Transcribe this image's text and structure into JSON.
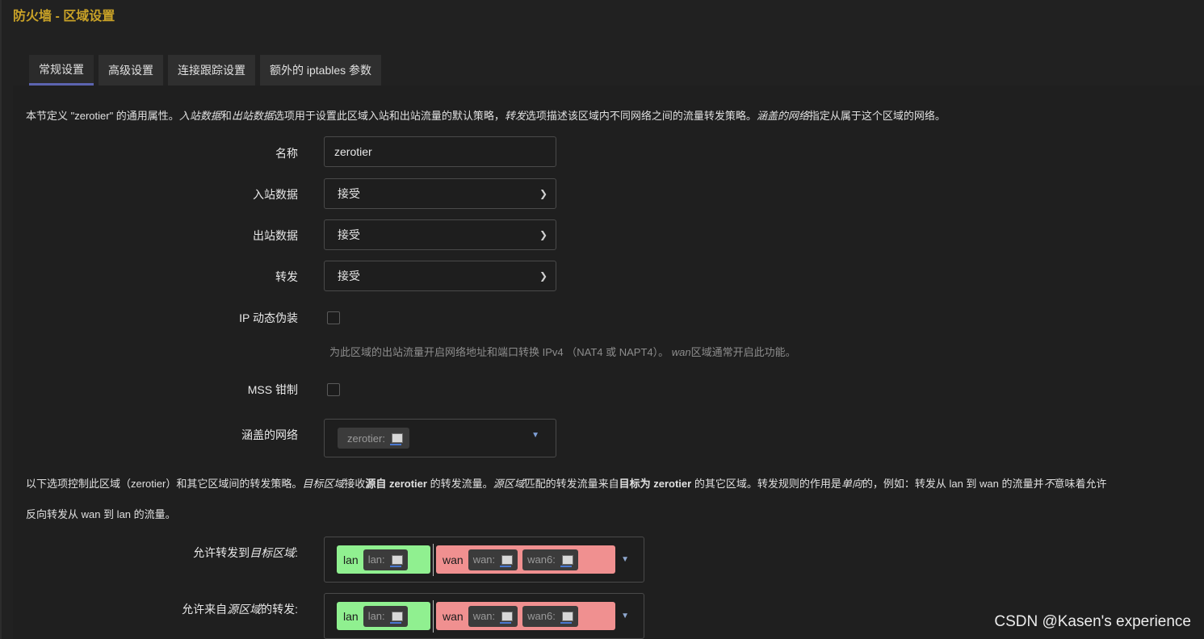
{
  "page": {
    "title": "防火墙 - 区域设置"
  },
  "tabs": [
    {
      "label": "常规设置",
      "active": true
    },
    {
      "label": "高级设置",
      "active": false
    },
    {
      "label": "连接跟踪设置",
      "active": false
    },
    {
      "label": "额外的 iptables 参数",
      "active": false
    }
  ],
  "general": {
    "desc_parts": {
      "p1": "本节定义 \"zerotier\" 的通用属性。",
      "i1": "入站数据",
      "p2": "和",
      "i2": "出站数据",
      "p3": "选项用于设置此区域入站和出站流量的默认策略，",
      "i3": "转发",
      "p4": "选项描述该区域内不同网络之间的流量转发策略。",
      "i4": "涵盖的网络",
      "p5": "指定从属于这个区域的网络。"
    },
    "name_label": "名称",
    "name_value": "zerotier",
    "input_label": "入站数据",
    "input_value": "接受",
    "output_label": "出站数据",
    "output_value": "接受",
    "forward_label": "转发",
    "forward_value": "接受",
    "masq_label": "IP 动态伪装",
    "masq_hint_main": "为此区域的出站流量开启网络地址和端口转换 IPv4 （NAT4 或 NAPT4）。",
    "masq_hint_wan": "wan",
    "masq_hint_tail": "区域通常开启此功能。",
    "mss_label": "MSS 钳制",
    "covered_label": "涵盖的网络",
    "covered_network": "zerotier:"
  },
  "forwarding": {
    "desc1_parts": {
      "p1": "以下选项控制此区域（zerotier）和其它区域间的转发策略。",
      "i1": "目标区域",
      "p2": "接收",
      "b1": "源自 zerotier",
      "p3": " 的转发流量。",
      "i2": "源区域",
      "p4": "匹配的转发流量来自",
      "b2": "目标为 zerotier",
      "p5": " 的其它区域。转发规则的作用是",
      "i3": "单向",
      "p6": "的，例如：转发从 lan 到 wan 的流量并",
      "i4": "不",
      "p7": "意味着允许"
    },
    "desc2": "反向转发从 wan 到 lan 的流量。",
    "dest_label_prefix": "允许转发到",
    "dest_label_italic": "目标区域",
    "dest_label_suffix": ":",
    "src_label_prefix": "允许来自",
    "src_label_italic": "源区域",
    "src_label_suffix": "的转发:",
    "lan_zone": "lan",
    "lan_net": "lan:",
    "wan_zone": "wan",
    "wan_net": "wan:",
    "wan6_net": "wan6:",
    "lan_color": "#90f090",
    "wan_color": "#f09090"
  },
  "watermark": "CSDN @Kasen's experience",
  "colors": {
    "title": "#c9a227",
    "tab_active_underline": "#5c64b0"
  },
  "icons": [
    "network-icon",
    "chevron-down-icon",
    "dropdown-caret-icon"
  ]
}
